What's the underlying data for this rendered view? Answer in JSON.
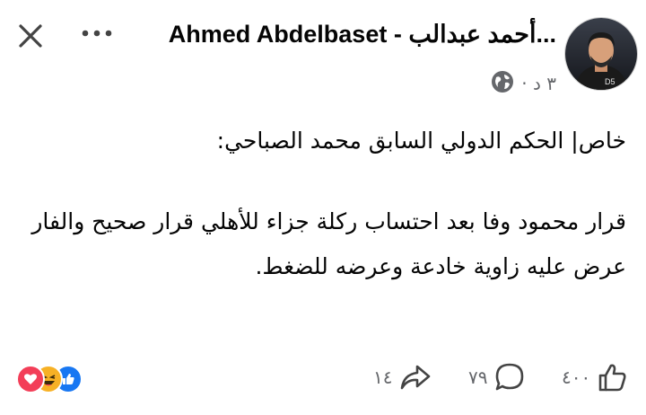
{
  "post": {
    "author": "Ahmed Abdelbaset - أحمد عبدالب...",
    "time": "٣ د ·",
    "paragraph1": "خاص| الحكم الدولي السابق محمد الصباحي:",
    "paragraph2": "قرار محمود وفا بعد احتساب ركلة جزاء للأهلي قرار صحيح والفار عرض عليه زاوية خادعة وعرضه للضغط."
  },
  "actions": {
    "likes": "٤٠٠",
    "comments": "٧٩",
    "shares": "١٤"
  },
  "icons": {
    "close": "close-icon",
    "more": "more-dots-icon",
    "privacy": "globe-icon",
    "like": "thumbs-up-icon",
    "comment": "comment-bubble-icon",
    "share": "share-arrow-icon",
    "reactions": [
      "love-reaction-icon",
      "haha-reaction-icon",
      "like-reaction-icon"
    ]
  },
  "colors": {
    "text": "#050505",
    "secondary": "#65676b",
    "like_blue": "#1877f2",
    "love_red": "#f33e58",
    "haha_yellow": "#f7b125"
  }
}
